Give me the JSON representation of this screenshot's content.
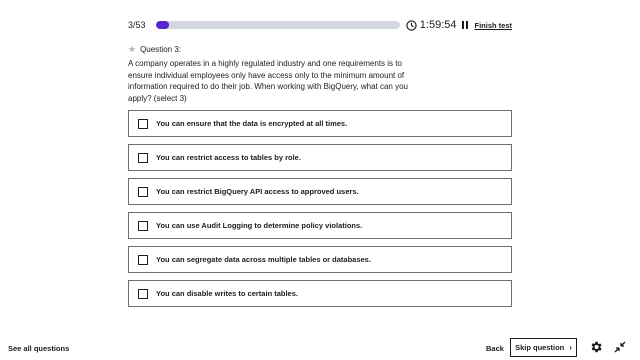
{
  "header": {
    "counter": "3/53",
    "progress": 0.057,
    "timer": "1:59:54",
    "finish_label": "Finish test",
    "clock_icon": "clock-icon",
    "pause_icon": "pause-icon"
  },
  "question": {
    "number_label": "Question 3:",
    "star_icon": "star-icon",
    "text": "A company operates in a highly regulated industry and one requirements is to ensure individual employees only have access only to the minimum amount of information required to do their job. When working with BigQuery, what can you apply? (select 3)"
  },
  "options": [
    {
      "label": "You can ensure that the data is encrypted at all times."
    },
    {
      "label": "You can restrict access to tables by role."
    },
    {
      "label": "You can restrict BigQuery API access to approved users."
    },
    {
      "label": "You can use Audit Logging to determine policy violations."
    },
    {
      "label": "You can segregate data across multiple tables or databases."
    },
    {
      "label": "You can disable writes to certain tables."
    }
  ],
  "footer": {
    "see_all": "See all questions",
    "back": "Back",
    "skip": "Skip question",
    "skip_icon": "chevron-right-icon",
    "settings_icon": "gear-icon",
    "collapse_icon": "collapse-icon"
  },
  "colors": {
    "accent": "#5624d0",
    "track": "#d1d7dc",
    "text": "#1c1d1f",
    "border": "#6a6f73"
  }
}
